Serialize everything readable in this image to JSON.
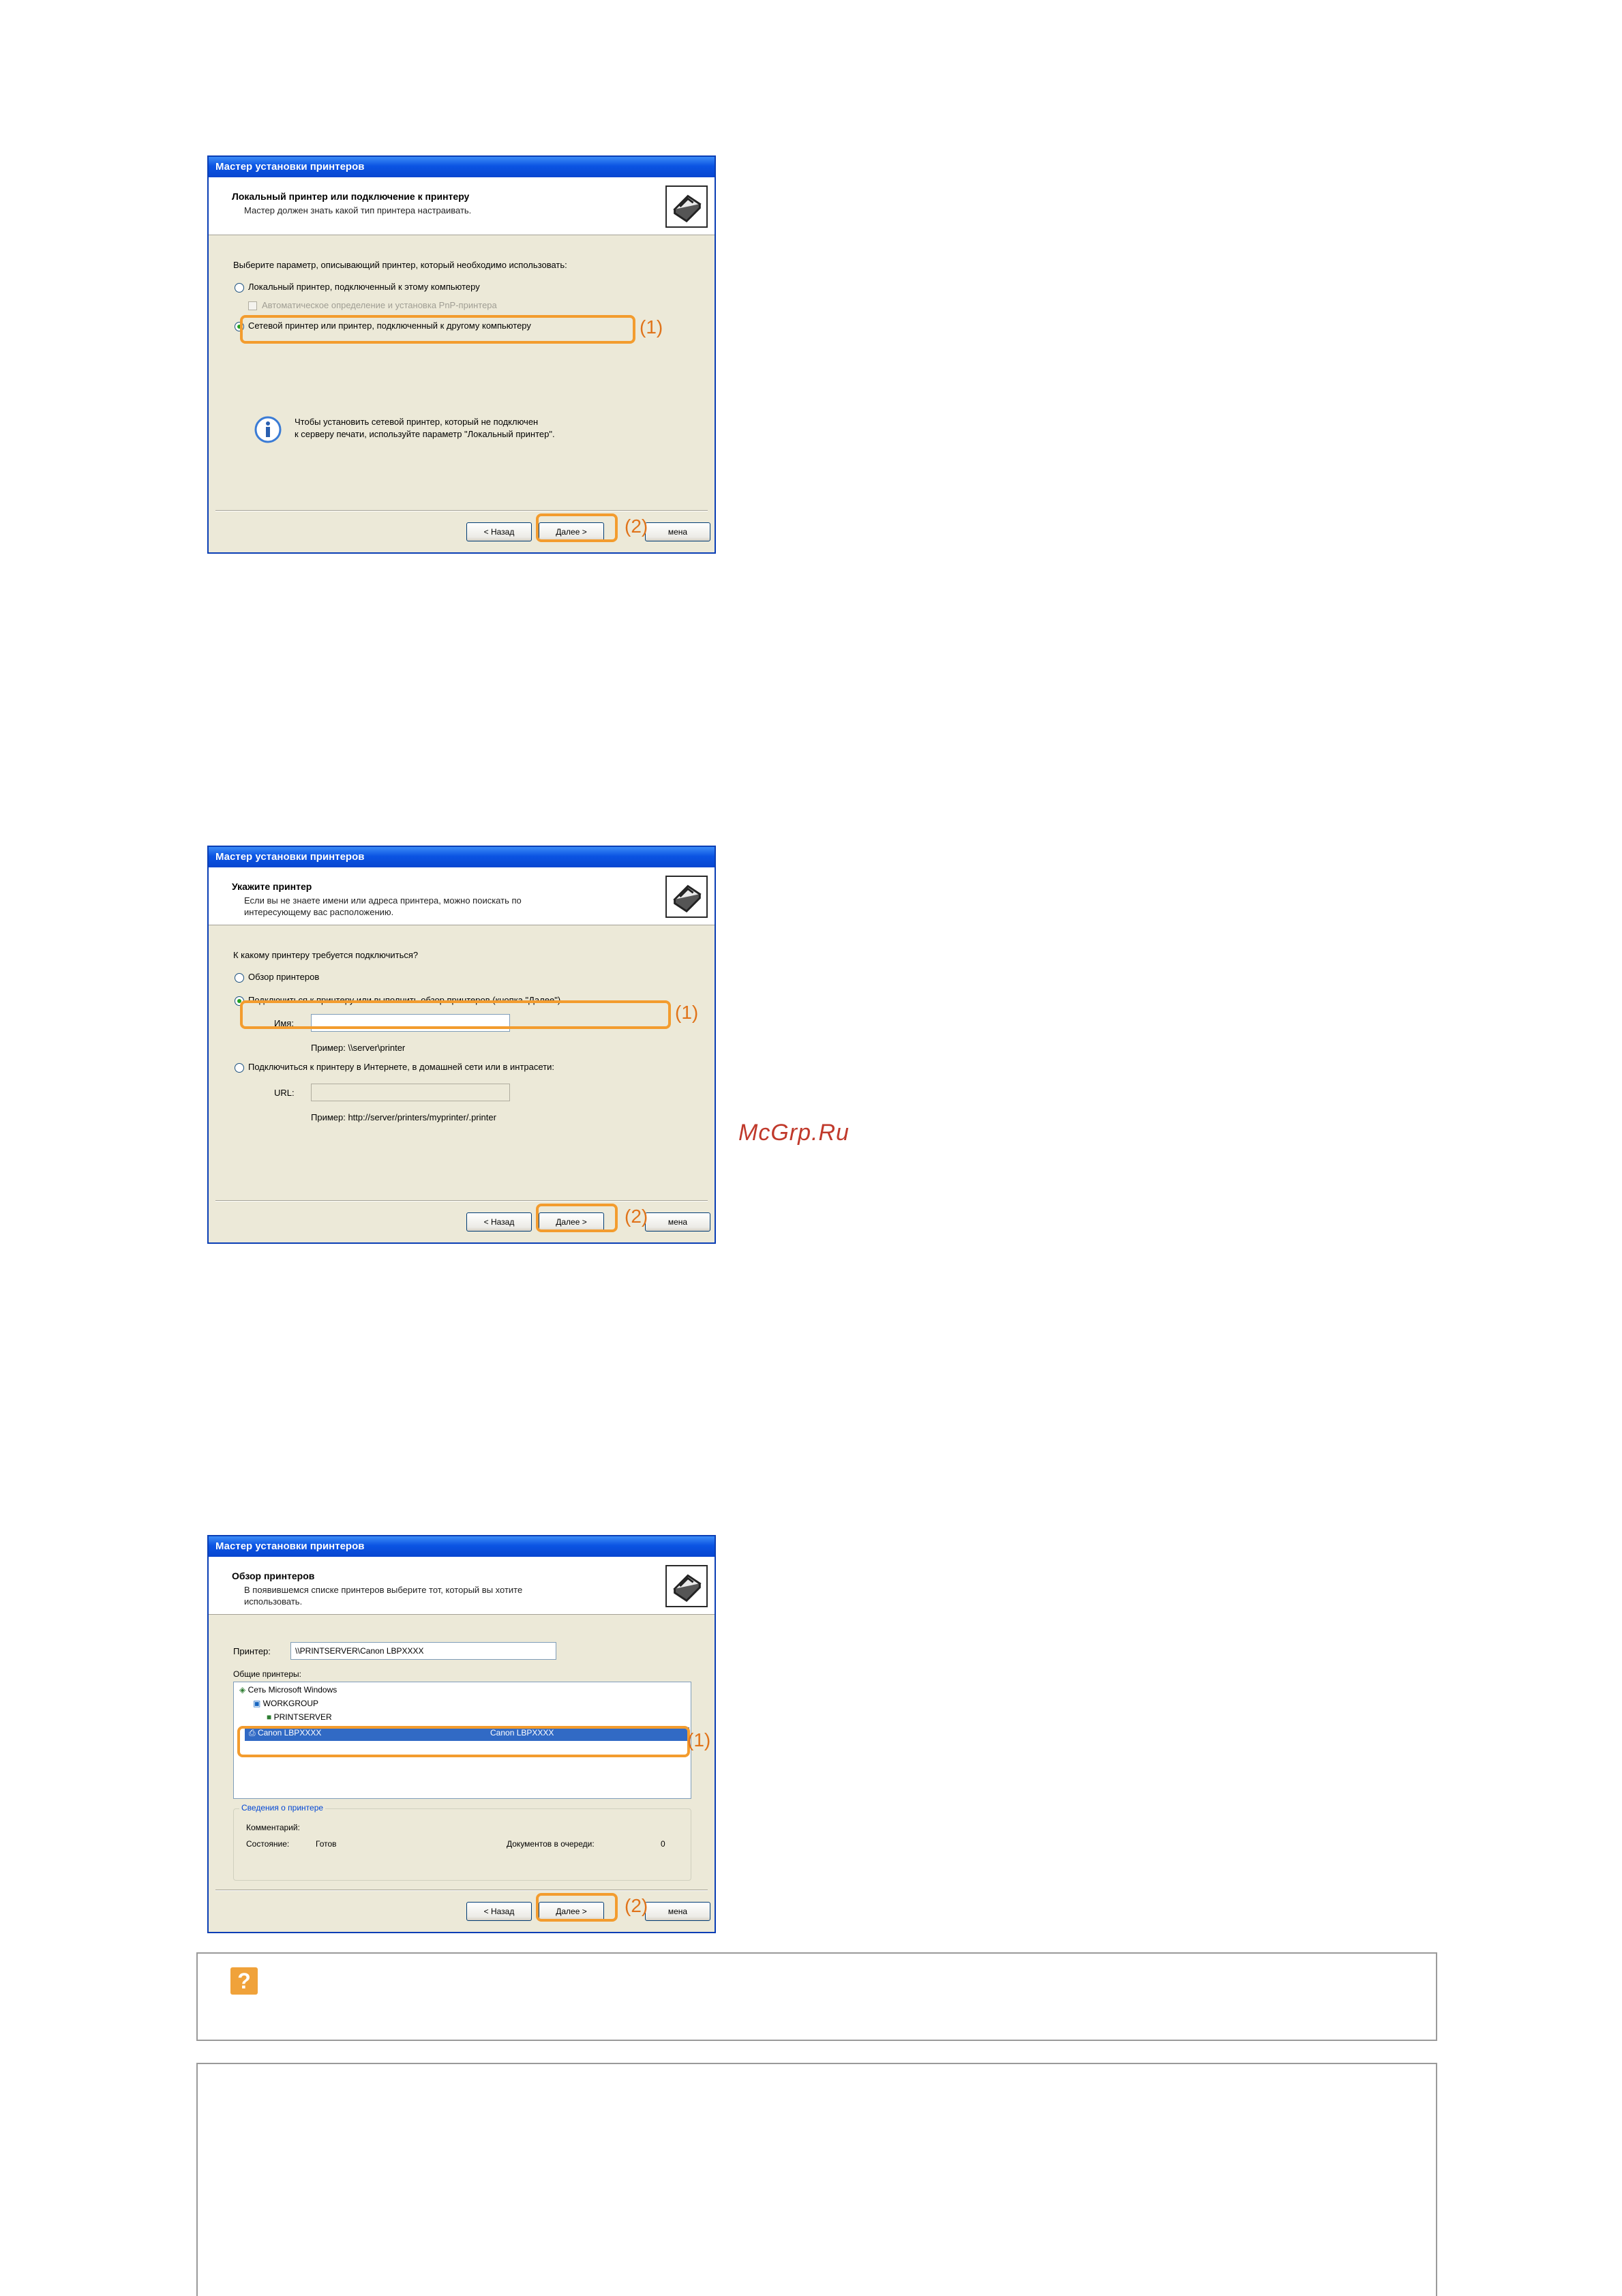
{
  "colors": {
    "highlight": "#f39c2e",
    "annotation": "#e0731a",
    "title_bar": "#0b54e3",
    "selection": "#316ac5",
    "watermark": "#c0392b"
  },
  "annotations": {
    "one": "(1)",
    "two": "(2)"
  },
  "watermark": "McGrp.Ru",
  "wizard1": {
    "title": "Мастер установки принтеров",
    "header_title": "Локальный принтер или подключение к принтеру",
    "header_sub": "Мастер должен знать какой тип принтера настраивать.",
    "prompt": "Выберите параметр, описывающий принтер, который необходимо использовать:",
    "option_local": "Локальный принтер, подключенный к этому компьютеру",
    "option_pnp": "Автоматическое определение и установка PnP-принтера",
    "option_network": "Сетевой принтер или принтер, подключенный к другому компьютеру",
    "info_line1": "Чтобы установить сетевой принтер, который не подключен",
    "info_line2": "к серверу печати, используйте параметр \"Локальный принтер\".",
    "back_button": "< Назад",
    "next_button": "Далее >",
    "cancel_fragment": "мена"
  },
  "wizard2": {
    "title": "Мастер установки принтеров",
    "header_title": "Укажите принтер",
    "header_sub_line1": "Если вы не знаете имени или адреса принтера, можно поискать по",
    "header_sub_line2": "интересующему вас расположению.",
    "prompt": "К какому принтеру требуется подключиться?",
    "option_browse": "Обзор принтеров",
    "option_connect": "Подключиться к принтеру или выполнить обзор принтеров (кнопка \"Далее\")",
    "name_label": "Имя:",
    "name_value": "",
    "name_example": "Пример: \\\\server\\printer",
    "option_internet": "Подключиться к принтеру в Интернете, в домашней сети или в интрасети:",
    "url_label": "URL:",
    "url_value": "",
    "url_example": "Пример: http://server/printers/myprinter/.printer",
    "back_button": "< Назад",
    "next_button": "Далее >",
    "cancel_fragment": "мена"
  },
  "wizard3": {
    "title": "Мастер установки принтеров",
    "header_title": "Обзор принтеров",
    "header_sub_line1": "В появившемся списке принтеров выберите тот, который вы хотите",
    "header_sub_line2": "использовать.",
    "printer_label": "Принтер:",
    "printer_value": "\\\\PRINTSERVER\\Canon LBPXXXX",
    "shared_label": "Общие принтеры:",
    "tree": {
      "network": "Сеть Microsoft Windows",
      "workgroup": "WORKGROUP",
      "server": "PRINTSERVER",
      "printer_name": "Canon LBPXXXX",
      "printer_comment": "Canon LBPXXXX"
    },
    "info_group_title": "Сведения о принтере",
    "comment_label": "Комментарий:",
    "status_label": "Состояние:",
    "status_value": "Готов",
    "queue_label": "Документов в очереди:",
    "queue_value": "0",
    "back_button": "< Назад",
    "next_button": "Далее >",
    "cancel_fragment": "мена"
  },
  "notes": {
    "help_icon": "question-icon",
    "help_icon_glyph": "?"
  }
}
